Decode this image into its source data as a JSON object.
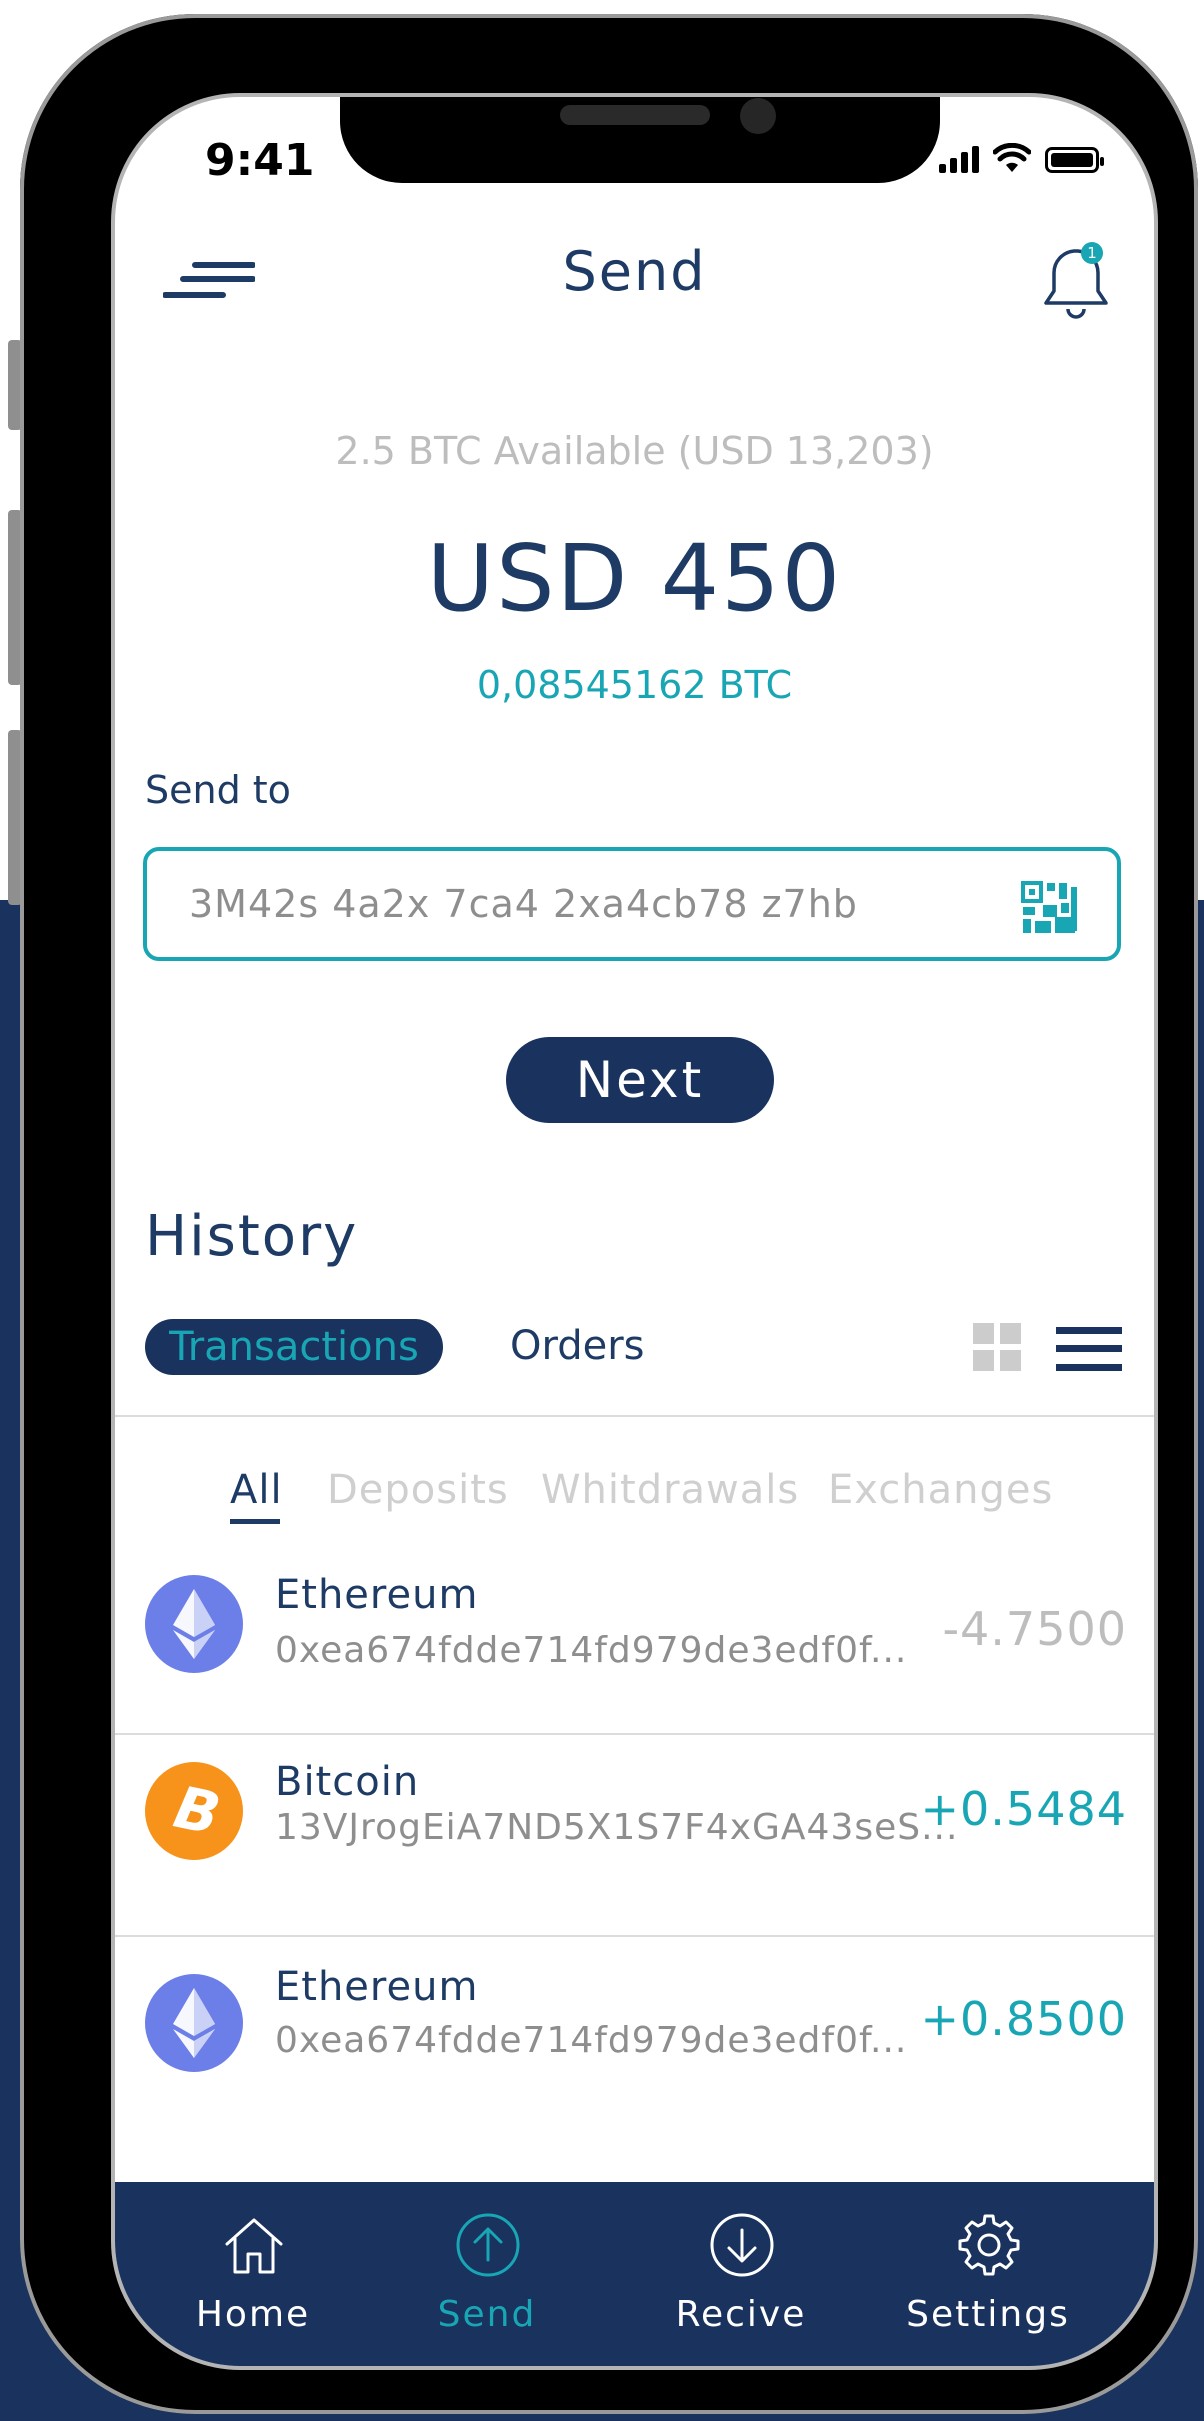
{
  "status": {
    "time": "9:41"
  },
  "header": {
    "title": "Send",
    "notification_count": "1"
  },
  "balance": {
    "available": "2.5 BTC Available (USD 13,203)",
    "amount": "USD 450",
    "btc_equivalent": "0,08545162 BTC"
  },
  "send_to": {
    "label": "Send to",
    "address": "3M42s  4a2x 7ca4 2xa4cb78 z7hb"
  },
  "next_button": {
    "label": "Next"
  },
  "history": {
    "title": "History",
    "tabs": [
      {
        "label": "Transactions",
        "active": true
      },
      {
        "label": "Orders",
        "active": false
      }
    ],
    "filters": [
      {
        "label": "All",
        "active": true
      },
      {
        "label": "Deposits",
        "active": false
      },
      {
        "label": "Whitdrawals",
        "active": false
      },
      {
        "label": "Exchanges",
        "active": false
      }
    ],
    "transactions": [
      {
        "coin": "Ethereum",
        "icon": "ethereum-icon",
        "address": "0xea674fdde714fd979de3edf0f...",
        "amount": "-4.7500",
        "amount_color": "#bdbdbd"
      },
      {
        "coin": "Bitcoin",
        "icon": "bitcoin-icon",
        "address": "13VJrogEiA7ND5X1S7F4xGA43seS...",
        "amount": "+0.5484",
        "amount_color": "#19a6b4"
      },
      {
        "coin": "Ethereum",
        "icon": "ethereum-icon",
        "address": "0xea674fdde714fd979de3edf0f...",
        "amount": "+0.8500",
        "amount_color": "#19a6b4"
      }
    ]
  },
  "tabbar": {
    "items": [
      {
        "label": "Home",
        "icon": "home-icon",
        "active": false
      },
      {
        "label": "Send",
        "icon": "send-icon",
        "active": true
      },
      {
        "label": "Recive",
        "icon": "receive-icon",
        "active": false
      },
      {
        "label": "Settings",
        "icon": "settings-icon",
        "active": false
      }
    ]
  },
  "colors": {
    "navy": "#19325e",
    "teal": "#19a6b4",
    "text_dark": "#1d3b64",
    "ethereum": "#6c7fe8",
    "bitcoin": "#f7931a"
  }
}
